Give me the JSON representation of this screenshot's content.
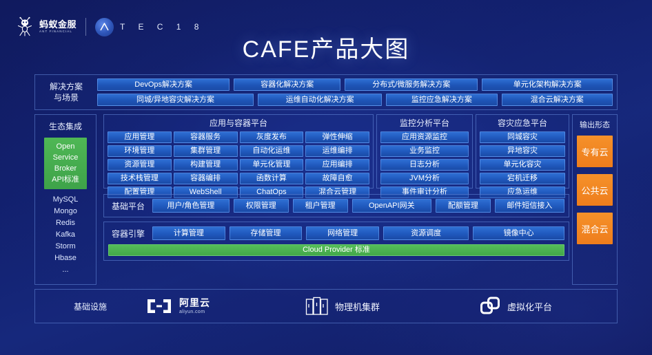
{
  "header": {
    "ant_brand_cn": "蚂蚁金服",
    "ant_brand_en": "ANT FINANCIAL",
    "atec_letters": "T E C 1 8"
  },
  "title": "CAFE产品大图",
  "solutions": {
    "label": "解决方案\n与场景",
    "label_line1": "解决方案",
    "label_line2": "与场景",
    "row1": [
      {
        "text": "DevOps解决方案",
        "flex": 2.03
      },
      {
        "text": "容器化解决方案",
        "flex": 1.63
      },
      {
        "text": "分布式/微服务解决方案",
        "flex": 2.04
      },
      {
        "text": "单元化架构解决方案",
        "flex": 2.0
      }
    ],
    "row2": [
      {
        "text": "同城/异地容灾解决方案",
        "flex": 2.4
      },
      {
        "text": "运维自动化解决方案",
        "flex": 1.9
      },
      {
        "text": "监控应急解决方案",
        "flex": 1.7
      },
      {
        "text": "混合云解决方案",
        "flex": 1.7
      }
    ]
  },
  "eco": {
    "title": "生态集成",
    "green_lines": [
      "Open",
      "Service",
      "Broker",
      "API标准"
    ],
    "items": [
      "MySQL",
      "Mongo",
      "Redis",
      "Kafka",
      "Storm",
      "Hbase",
      "..."
    ]
  },
  "platforms": [
    {
      "key": "app_container",
      "title": "应用与容器平台",
      "columns": 4,
      "cells": [
        "应用管理",
        "容器服务",
        "灰度发布",
        "弹性伸缩",
        "环境管理",
        "集群管理",
        "自动化运维",
        "运维编排",
        "资源管理",
        "构建管理",
        "单元化管理",
        "应用编排",
        "技术栈管理",
        "容器编排",
        "函数计算",
        "故障自愈",
        "配置管理",
        "WebShell",
        "ChatOps",
        "混合云管理"
      ]
    },
    {
      "key": "monitor_analysis",
      "title": "监控分析平台",
      "columns": 1,
      "cells": [
        "应用资源监控",
        "业务监控",
        "日志分析",
        "JVM分析",
        "事件审计分析"
      ]
    },
    {
      "key": "disaster_recovery",
      "title": "容灾应急平台",
      "columns": 1,
      "cells": [
        "同城容灾",
        "异地容灾",
        "单元化容灾",
        "宕机迁移",
        "应急运维"
      ]
    }
  ],
  "base_platform": {
    "label": "基础平台",
    "items": [
      {
        "text": "用户/角色管理",
        "flex": 1.55
      },
      {
        "text": "权限管理",
        "flex": 1.1
      },
      {
        "text": "租户管理",
        "flex": 1.1
      },
      {
        "text": "OpenAPI网关",
        "flex": 1.6
      },
      {
        "text": "配额管理",
        "flex": 1.1
      },
      {
        "text": "邮件短信接入",
        "flex": 1.4
      }
    ]
  },
  "container_engine": {
    "label": "容器引擎",
    "items": [
      {
        "text": "计算管理",
        "flex": 1
      },
      {
        "text": "存储管理",
        "flex": 1
      },
      {
        "text": "网络管理",
        "flex": 1
      },
      {
        "text": "资源调度",
        "flex": 1.18
      },
      {
        "text": "镜像中心",
        "flex": 1.26
      }
    ],
    "cloud_provider": "Cloud Provider 标准"
  },
  "output_forms": {
    "title": "输出形态",
    "items": [
      "专有云",
      "公共云",
      "混合云"
    ]
  },
  "infrastructure": {
    "label": "基础设施",
    "items": [
      {
        "key": "aliyun",
        "cn": "阿里云",
        "en": "aliyun.com",
        "icon": "aliyun-logo-icon"
      },
      {
        "key": "physical",
        "text": "物理机集群",
        "icon": "server-rack-icon"
      },
      {
        "key": "virtual",
        "text": "虚拟化平台",
        "icon": "vmware-squares-icon"
      }
    ]
  },
  "colors": {
    "background_deep": "#101a5e",
    "background_mid": "#16287c",
    "chip_blue": "#2059bd",
    "accent_green": "#43a849",
    "accent_orange": "#ee7d1c",
    "border_blue": "#6e96e6"
  }
}
